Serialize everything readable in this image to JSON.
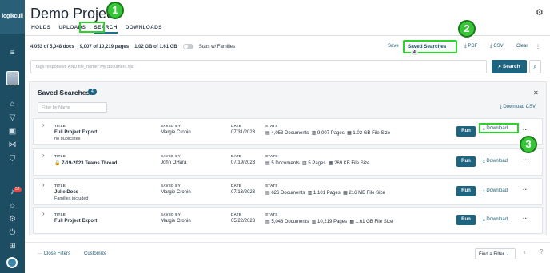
{
  "app": {
    "logo": "logikcull",
    "project_title": "Demo Project"
  },
  "tabs": [
    "HOLDS",
    "UPLOADS",
    "SEARCH",
    "DOWNLOADS"
  ],
  "stats": {
    "docs": "4,053 of 5,048 docs",
    "pages": "9,007 of 10,219 pages",
    "size": "1.02 GB of 1.61 GB",
    "families_label": "Stats w/ Families"
  },
  "toolbar": {
    "save": "Save",
    "saved_searches": "Saved Searches",
    "saved_count": "4",
    "pdf": "PDF",
    "csv": "CSV",
    "clear": "Clear"
  },
  "query": {
    "placeholder": "tags:responsive AND file_name:\"My document.xls\""
  },
  "search_button": "Search",
  "panel": {
    "title": "Saved Searches",
    "count": "4",
    "filter_placeholder": "Filter by Name",
    "download_csv": "Download CSV",
    "labels": {
      "title": "TITLE",
      "saved_by": "SAVED BY",
      "date": "DATE",
      "stats": "STATS"
    },
    "rows": [
      {
        "title": "Full Project Export",
        "sub": "no duplicates",
        "saved_by": "Margie Cronin",
        "date": "07/31/2023",
        "documents": "4,053 Documents",
        "pages": "9,007 Pages",
        "size": "1.02 GB File Size"
      },
      {
        "title": "7-19-2023 Teams Thread",
        "sub": "",
        "saved_by": "John OHara",
        "date": "07/19/2023",
        "documents": "5 Documents",
        "pages": "5 Pages",
        "size": "269 KB File Size"
      },
      {
        "title": "Julie Docs",
        "sub": "Families included",
        "saved_by": "Margie Cronin",
        "date": "07/13/2023",
        "documents": "626 Documents",
        "pages": "1,101 Pages",
        "size": "216 MB File Size"
      },
      {
        "title": "Full Project Export",
        "sub": "",
        "saved_by": "Margie Cronin",
        "date": "05/22/2023",
        "documents": "5,048 Documents",
        "pages": "10,219 Pages",
        "size": "1.61 GB File Size"
      }
    ],
    "run": "Run",
    "download": "Download"
  },
  "footer": {
    "close_filters": "Close Filters",
    "customize": "Customize",
    "find_filter": "Find a Filter"
  },
  "callouts": [
    "1",
    "2",
    "3"
  ],
  "colors": {
    "primary": "#1d6480",
    "sidebar": "#1d4d63",
    "highlight": "#2ed12e",
    "badge": "#e04848"
  }
}
